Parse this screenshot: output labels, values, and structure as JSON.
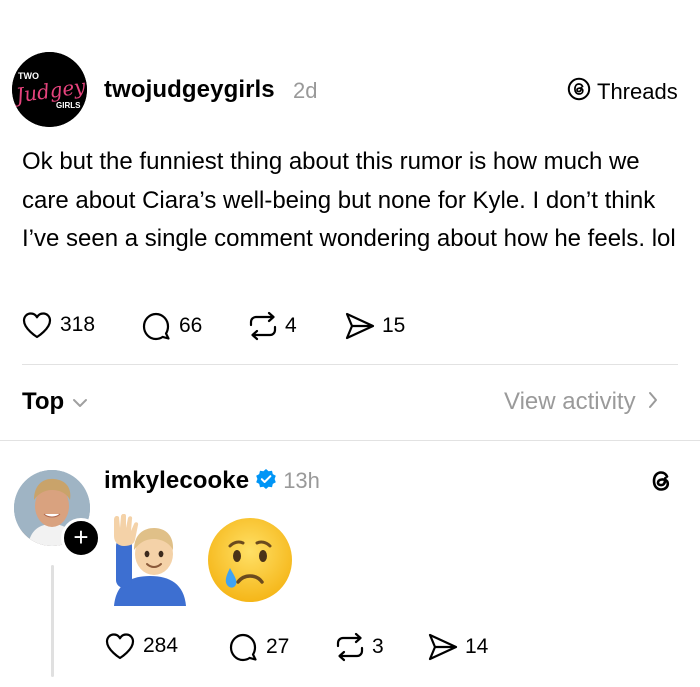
{
  "post": {
    "avatar_text": {
      "top": "TWO",
      "main": "Judgey",
      "bottom": "GIRLS"
    },
    "username": "twojudgeygirls",
    "time": "2d",
    "badge_label": "Threads",
    "text": "Ok but the funniest thing about this rumor is how much we care about Ciara’s well-being but none for Kyle. I don’t think I’ve seen a single comment wondering about how he feels. lol",
    "likes": "318",
    "comments": "66",
    "reposts": "4",
    "shares": "15"
  },
  "filter": {
    "sort_label": "Top",
    "view_activity_label": "View activity"
  },
  "reply": {
    "username": "imkylecooke",
    "time": "13h",
    "emojis": [
      "raising-hand-man",
      "crying-face"
    ],
    "likes": "284",
    "comments": "27",
    "reposts": "3",
    "shares": "14"
  },
  "colors": {
    "secondary_text": "#999999",
    "divider": "#e2e2e2",
    "verified": "#0095f6",
    "brand_pink": "#e6437d"
  }
}
